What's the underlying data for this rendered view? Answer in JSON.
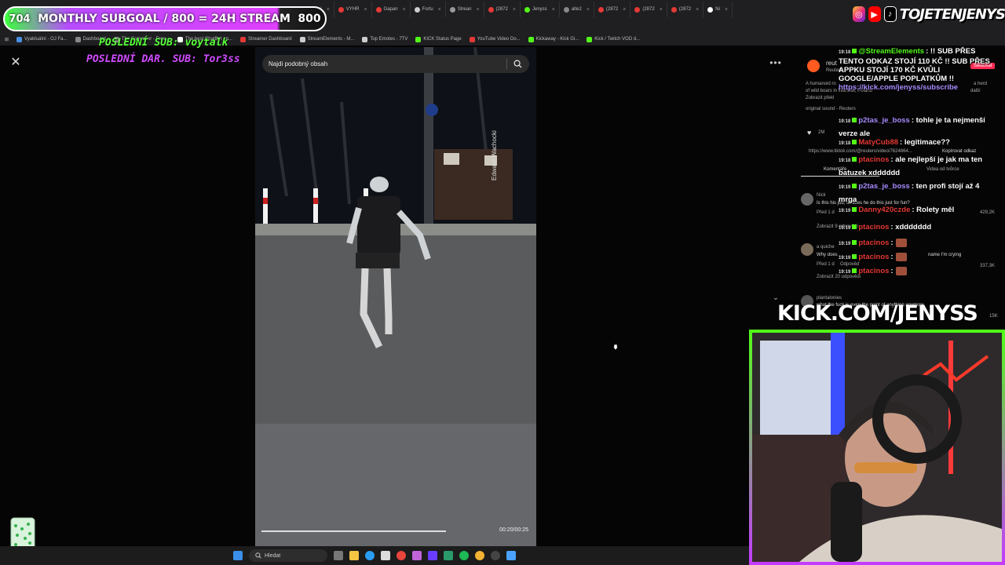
{
  "overlay": {
    "subgoal_count": "704",
    "subgoal_title": "MONTHLY SUBGOAL / 800 = 24H STREAM",
    "subgoal_target": "800",
    "last_sub": "POSLEDNÍ SUB: voytalk",
    "last_donation": "POSLEDNÍ DAR. SUB: Tor3ss",
    "kick_url": "KICK.COM/JENYSS",
    "social_handle": "TOJETENJENYS"
  },
  "browser": {
    "tabs": [
      {
        "label": "Elibei",
        "color": "#e53935"
      },
      {
        "label": "VYHR",
        "color": "#e53935"
      },
      {
        "label": "Gapan",
        "color": "#e53935"
      },
      {
        "label": "Fortu",
        "color": "#cccccc"
      },
      {
        "label": "Strean",
        "color": "#999999"
      },
      {
        "label": "(2872",
        "color": "#e53935"
      },
      {
        "label": "Jenyss",
        "color": "#53fc18"
      },
      {
        "label": "alte2",
        "color": "#888888"
      },
      {
        "label": "(2872",
        "color": "#e53935"
      },
      {
        "label": "(2872",
        "color": "#e53935"
      },
      {
        "label": "(2872",
        "color": "#e53935"
      },
      {
        "label": "Ni",
        "color": "#ffffff"
      }
    ],
    "bookmarks": [
      {
        "label": "Vyaktuální - OJ Fa...",
        "color": "#4a90e2"
      },
      {
        "label": "Dashboard",
        "color": "#888888"
      },
      {
        "label": "The Converter - Free...",
        "color": "#888888"
      },
      {
        "label": "The best ChatBot an...",
        "color": "#ffffff"
      },
      {
        "label": "Streamer Dashboard",
        "color": "#e53935"
      },
      {
        "label": "StreamElements - M...",
        "color": "#cccccc"
      },
      {
        "label": "Top Emotes - 7TV",
        "color": "#cccccc"
      },
      {
        "label": "KICK Status Page",
        "color": "#53fc18"
      },
      {
        "label": "YouTube Video Do...",
        "color": "#e53935"
      },
      {
        "label": "Kickaway - Kick Gi...",
        "color": "#53fc18"
      },
      {
        "label": "Kick / Twitch VOD d...",
        "color": "#53fc18"
      }
    ]
  },
  "viewer": {
    "search_placeholder": "Najdi podobný obsah",
    "watermark": "Edward Wachocki",
    "timecode": "00:20/00:25",
    "progress": 0.8
  },
  "comments": {
    "poster": "reut",
    "poster_sub": "Reuters",
    "follow": "Sledovat",
    "desc_1": "A humanoid ro",
    "desc_2": "a herd",
    "desc_3": "of wild boars in Warsaw, Poland",
    "desc_more": "další",
    "show_translation": "Zobrazit překl",
    "sound": "original sound - Reuters",
    "likes": "2M",
    "link": "https://www.tiktok.com/@reuters/video/7624864...",
    "copy_link": "Kopírovat odkaz",
    "tab_comments": "Komentáře",
    "tab_creator": "Videa od tvůrce",
    "c1_user": "Nick",
    "c1_text": "Is this his job, or does he do this just for fun?",
    "c1_meta": "Před 1 d",
    "c1_likes": "429,2K",
    "c1_replies": "Zobrazit 9 odpovědí",
    "c2_user": "a quiche",
    "c2_text_a": "Why does",
    "c2_text_b": "name I'm crying",
    "c2_meta": "Před 1 d",
    "c2_reply": "Odpověď",
    "c2_likes": "337,3K",
    "c2_replies": "Zobrazit 20 odpovědí",
    "c3_user": "plantalonies",
    "c3_text": "what the fuck is even the point of anything anymore",
    "c3_likes": "15K"
  },
  "chat": [
    {
      "time": "19:18",
      "name": "@StreamElements",
      "name_color": "#53fc18",
      "text": ": !! SUB PŘES TENTO ODKAZ STOJÍ 110 KČ !! SUB PŘES APPKU STOJÍ 170 KČ KVŮLI GOOGLE/APPLE POPLATKŮM !!",
      "link": "https://kick.com/jenyss/subscribe"
    },
    {
      "time": "19:18",
      "name": "p2tas_je_boss",
      "name_color": "#a98bff",
      "text": ": tohle je ta nejmenší verze ale"
    },
    {
      "time": "19:18",
      "name": "MatyCub88",
      "name_color": "#e53935",
      "text": ": legitimace??"
    },
    {
      "time": "19:18",
      "name": "ptacinos",
      "name_color": "#e53935",
      "text": ": ale nejlepší je jak ma ten batuzek xdddddd"
    },
    {
      "time": "19:19",
      "name": "p2tas_je_boss",
      "name_color": "#a98bff",
      "text": ": ten profi stojí až 4 mrga"
    },
    {
      "time": "19:19",
      "name": "Danny420czde",
      "name_color": "#e53935",
      "text": ": Rolety měl"
    },
    {
      "time": "19:19",
      "name": "ptacinos",
      "name_color": "#e53935",
      "text": ": xddddddd"
    },
    {
      "time": "19:19",
      "name": "ptacinos",
      "name_color": "#e53935",
      "text": ":"
    },
    {
      "time": "19:19",
      "name": "ptacinos",
      "name_color": "#e53935",
      "text": ":"
    },
    {
      "time": "19:19",
      "name": "ptacinos",
      "name_color": "#e53935",
      "text": ":"
    }
  ],
  "taskbar": {
    "search_label": "Hledat",
    "icons": [
      "start-icon",
      "search-icon",
      "task-view-icon",
      "file-explorer-icon",
      "edge-icon",
      "store-icon",
      "chrome-icon",
      "discord-icon",
      "app-icon",
      "app-icon-2",
      "spotify-icon",
      "chrome-2-icon",
      "obs-icon",
      "notepad-icon"
    ]
  }
}
